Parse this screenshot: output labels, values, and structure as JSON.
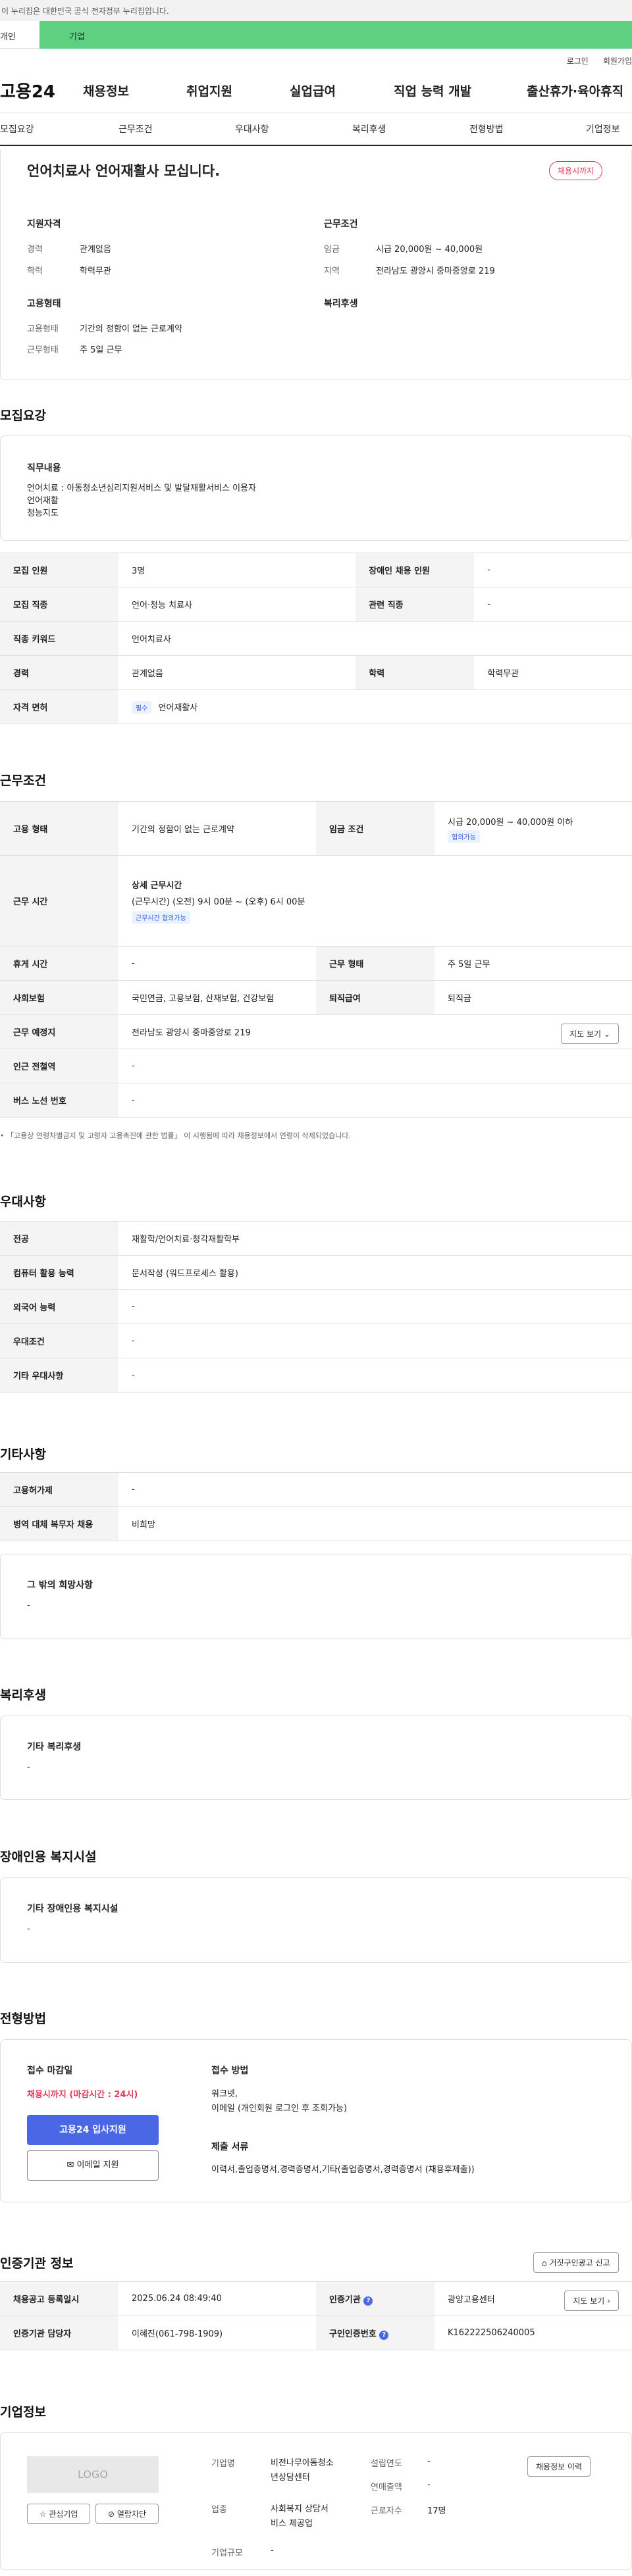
{
  "gov_banner": "이 누리집은 대한민국 공식 전자정부 누리집입니다.",
  "top_tabs": {
    "individual": "개인",
    "business": "기업"
  },
  "util": {
    "login": "로그인",
    "signup": "회원가입"
  },
  "logo": "고용24",
  "gnb": [
    "채용정보",
    "취업지원",
    "실업급여",
    "직업 능력 개발",
    "출산휴가·육아휴직"
  ],
  "subnav": [
    "모집요강",
    "근무조건",
    "우대사항",
    "복리후생",
    "전형방법",
    "기업정보"
  ],
  "summary": {
    "title": "언어치료사 언어재활사 모십니다.",
    "deadline_badge": "채용시까지",
    "qual_title": "지원자격",
    "career_label": "경력",
    "career_value": "관계없음",
    "edu_label": "학력",
    "edu_value": "학력무관",
    "cond_title": "근무조건",
    "wage_label": "임금",
    "wage_value": "시급 20,000원 ~ 40,000원",
    "area_label": "지역",
    "area_value": "전라남도 광양시 중마중앙로 219",
    "emp_title": "고용형태",
    "emptype_label": "고용형태",
    "emptype_value": "기간의 정함이 없는 근로계약",
    "worktype_label": "근무형태",
    "worktype_value": "주 5일 근무",
    "welfare_title": "복리후생"
  },
  "recruit": {
    "section_title": "모집요강",
    "duty_title": "직무내용",
    "duty_lines": [
      "언어치료 : 아동청소년심리지원서비스 및 발달재활서비스 이용자",
      "언어재활",
      "청능지도"
    ],
    "rows": [
      {
        "l1": "모집 인원",
        "v1": "3명",
        "l2": "장애인 채용 인원",
        "v2": "-"
      },
      {
        "l1": "모집 직종",
        "v1": "언어·청능 치료사",
        "l2": "관련 직종",
        "v2": "-"
      }
    ],
    "keyword_label": "직종 키워드",
    "keyword_value": "언어치료사",
    "career_label": "경력",
    "career_value": "관계없음",
    "edu_label": "학력",
    "edu_value": "학력무관",
    "license_label": "자격 면허",
    "license_tag": "필수",
    "license_value": "언어재활사"
  },
  "work": {
    "section_title": "근무조건",
    "emp_label": "고용 형태",
    "emp_value": "기간의 정함이 없는 근로계약",
    "wage_label": "임금 조건",
    "wage_value": "시급 20,000원 ~ 40,000원 이하",
    "wage_tag": "협의가능",
    "hours_label": "근무 시간",
    "hours_title": "상세 근무시간",
    "hours_value": "(근무시간) (오전) 9시 00분 ~ (오후) 6시 00분",
    "hours_tag": "근무시간 협의가능",
    "rest_label": "휴게 시간",
    "rest_value": "-",
    "form_label": "근무 형태",
    "form_value": "주 5일 근무",
    "ins_label": "사회보험",
    "ins_value": "국민연금, 고용보험, 산재보험, 건강보험",
    "retire_label": "퇴직급여",
    "retire_value": "퇴직금",
    "place_label": "근무 예정지",
    "place_value": "전라남도 광양시 중마중앙로 219",
    "map_btn": "지도 보기",
    "station_label": "인근 전철역",
    "station_value": "-",
    "bus_label": "버스 노선 번호",
    "bus_value": "-",
    "note": "「고용상 연령차별금지 및 고령자 고용촉진에 관한 법률」 이 시행됨에 따라 채용정보에서 연령이 삭제되었습니다."
  },
  "pref": {
    "section_title": "우대사항",
    "rows": [
      {
        "l": "전공",
        "v": "재활학/언어치료·청각재활학부"
      },
      {
        "l": "컴퓨터 활용 능력",
        "v": "문서작성 (워드프로세스 활용)"
      },
      {
        "l": "외국어 능력",
        "v": "-"
      },
      {
        "l": "우대조건",
        "v": "-"
      },
      {
        "l": "기타 우대사항",
        "v": "-"
      }
    ]
  },
  "etc": {
    "section_title": "기타사항",
    "rows": [
      {
        "l": "고용허가제",
        "v": "-"
      },
      {
        "l": "병역 대체 복무자 채용",
        "v": "비희망"
      }
    ],
    "other_title": "그 밖의 희망사항",
    "other_value": "-"
  },
  "welfare": {
    "section_title": "복리후생",
    "box_title": "기타 복리후생",
    "box_value": "-"
  },
  "disabled": {
    "section_title": "장애인용 복지시설",
    "box_title": "기타 장애인용 복지시설",
    "box_value": "-"
  },
  "screening": {
    "section_title": "전형방법",
    "deadline_title": "접수 마감일",
    "deadline_value": "채용시까지 (마감시간 : 24시)",
    "apply_btn": "고용24 입사지원",
    "email_btn": "이메일 지원",
    "method_title": "접수 방법",
    "method_lines": [
      "워크넷,",
      "이메일 (개인회원 로그인 후 조회가능)"
    ],
    "docs_title": "제출 서류",
    "docs_value": "이력서,졸업증명서,경력증명서,기타(졸업증명서,경력증명서 (채용후제출))"
  },
  "agency": {
    "section_title": "인증기관 정보",
    "report_btn": "거짓구인광고 신고",
    "reg_label": "채용공고 등록일시",
    "reg_value": "2025.06.24 08:49:40",
    "org_label": "인증기관",
    "org_value": "광양고용센터",
    "map_btn": "지도 보기",
    "manager_label": "인증기관 담당자",
    "manager_value": "이혜진(061-798-1909)",
    "num_label": "구인인증번호",
    "num_value": "K162222506240005"
  },
  "company": {
    "section_title": "기업정보",
    "logo_text": "LOGO",
    "fav_btn": "관심기업",
    "block_btn": "열람차단",
    "name_label": "기업명",
    "name_value_1": "비전나무아동청소",
    "name_value_2": "년상담센터",
    "year_label": "설립연도",
    "year_value": "-",
    "sales_label": "연매출액",
    "sales_value": "-",
    "ind_label": "업종",
    "ind_value_1": "사회복지 상담서",
    "ind_value_2": "비스 제공업",
    "emp_label": "근로자수",
    "emp_value": "17명",
    "size_label": "기업규모",
    "size_value": "-",
    "history_btn": "채용정보 이력"
  }
}
